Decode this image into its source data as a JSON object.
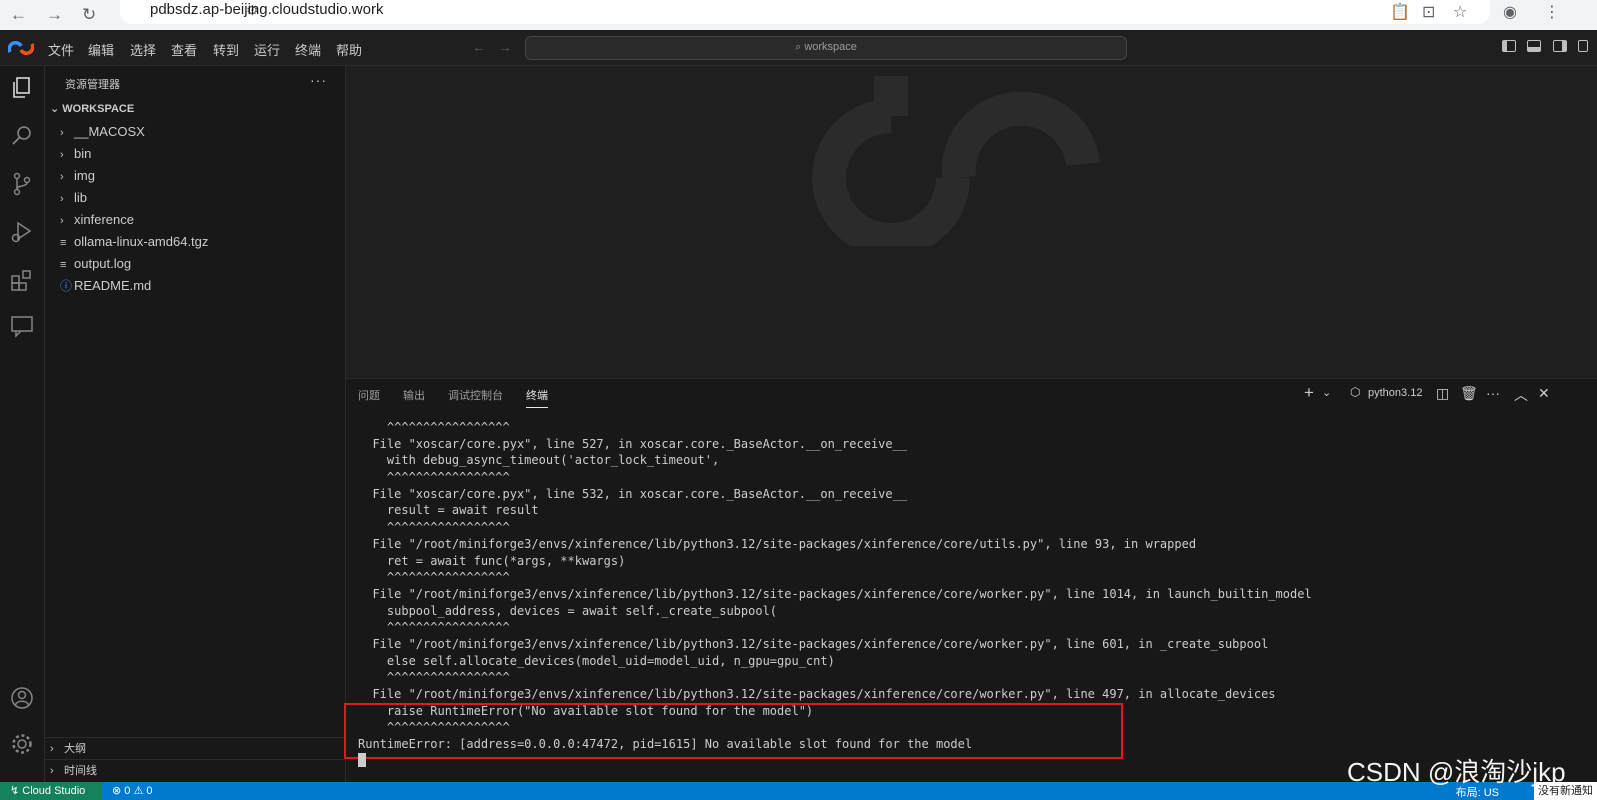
{
  "browser": {
    "url": "pdbsdz.ap-beijing.cloudstudio.work"
  },
  "menubar": {
    "items": [
      "文件",
      "编辑",
      "选择",
      "查看",
      "转到",
      "运行",
      "终端",
      "帮助"
    ],
    "command_center": "workspace"
  },
  "sidebar": {
    "title": "资源管理器",
    "more": "···",
    "workspace_label": "WORKSPACE",
    "tree": [
      {
        "name": "__MACOSX",
        "type": "folder"
      },
      {
        "name": "bin",
        "type": "folder"
      },
      {
        "name": "img",
        "type": "folder"
      },
      {
        "name": "lib",
        "type": "folder"
      },
      {
        "name": "xinference",
        "type": "folder"
      },
      {
        "name": "ollama-linux-amd64.tgz",
        "type": "file"
      },
      {
        "name": "output.log",
        "type": "file"
      },
      {
        "name": "README.md",
        "type": "info"
      }
    ],
    "outline_label": "大纲",
    "timeline_label": "时间线"
  },
  "panel": {
    "tabs": [
      "问题",
      "输出",
      "调试控制台",
      "终端"
    ],
    "active_tab": "终端",
    "terminal_profile": "python3.12",
    "terminal_lines": [
      "    ^^^^^^^^^^^^^^^^^",
      "  File \"xoscar/core.pyx\", line 527, in xoscar.core._BaseActor.__on_receive__",
      "    with debug_async_timeout('actor_lock_timeout',",
      "    ^^^^^^^^^^^^^^^^^",
      "  File \"xoscar/core.pyx\", line 532, in xoscar.core._BaseActor.__on_receive__",
      "    result = await result",
      "    ^^^^^^^^^^^^^^^^^",
      "  File \"/root/miniforge3/envs/xinference/lib/python3.12/site-packages/xinference/core/utils.py\", line 93, in wrapped",
      "    ret = await func(*args, **kwargs)",
      "    ^^^^^^^^^^^^^^^^^",
      "  File \"/root/miniforge3/envs/xinference/lib/python3.12/site-packages/xinference/core/worker.py\", line 1014, in launch_builtin_model",
      "    subpool_address, devices = await self._create_subpool(",
      "    ^^^^^^^^^^^^^^^^^",
      "  File \"/root/miniforge3/envs/xinference/lib/python3.12/site-packages/xinference/core/worker.py\", line 601, in _create_subpool",
      "    else self.allocate_devices(model_uid=model_uid, n_gpu=gpu_cnt)",
      "    ^^^^^^^^^^^^^^^^^",
      "  File \"/root/miniforge3/envs/xinference/lib/python3.12/site-packages/xinference/core/worker.py\", line 497, in allocate_devices",
      "    raise RuntimeError(\"No available slot found for the model\")",
      "    ^^^^^^^^^^^^^^^^^",
      "RuntimeError: [address=0.0.0.0:47472, pid=1615] No available slot found for the model"
    ]
  },
  "statusbar": {
    "remote": "Cloud Studio",
    "errors": "0",
    "warnings": "0",
    "layout": "布局: US",
    "notifications": "没有新通知"
  },
  "watermark": "CSDN @浪淘沙jkp",
  "colors": {
    "accent": "#007acc",
    "remote": "#16825d",
    "highlight_box": "#e0191c"
  }
}
